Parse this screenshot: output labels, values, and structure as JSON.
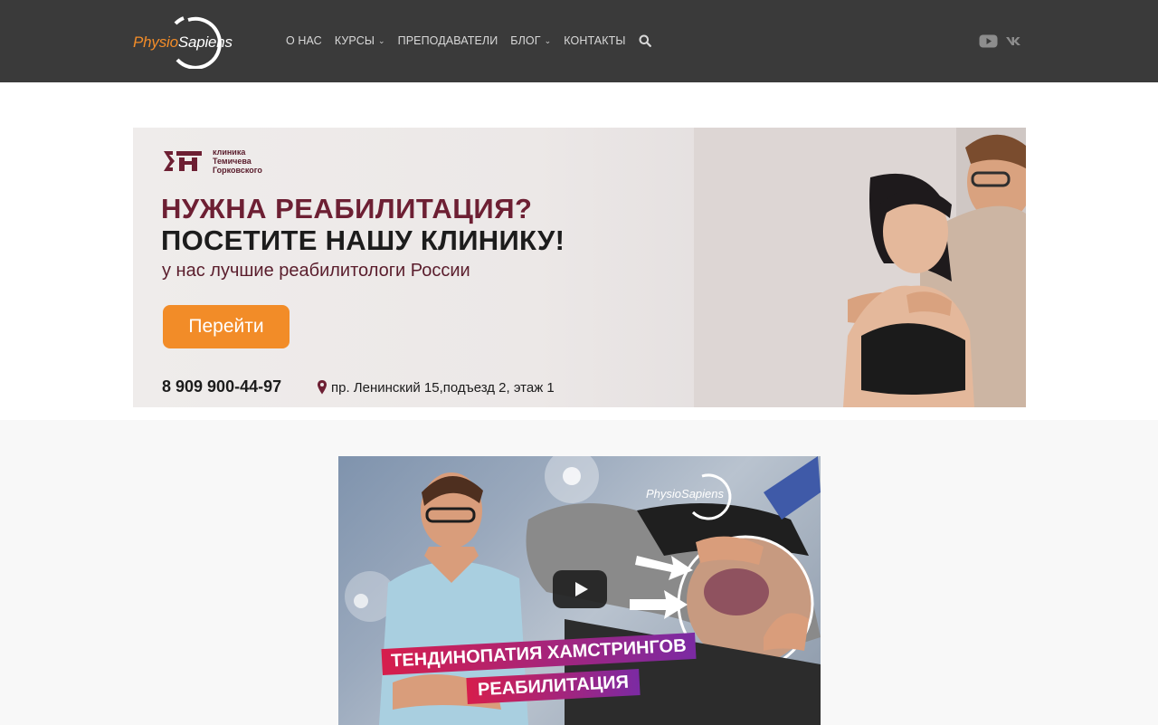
{
  "header": {
    "logo": {
      "part1": "Physio",
      "part2": "Sapiens"
    },
    "nav": [
      {
        "label": "О НАС",
        "has_dropdown": false
      },
      {
        "label": "КУРСЫ",
        "has_dropdown": true
      },
      {
        "label": "ПРЕПОДАВАТЕЛИ",
        "has_dropdown": false
      },
      {
        "label": "БЛОГ",
        "has_dropdown": true
      },
      {
        "label": "КОНТАКТЫ",
        "has_dropdown": false
      }
    ],
    "search_icon": "search-icon",
    "social": [
      "youtube-icon",
      "vk-icon"
    ],
    "colors": {
      "background": "#3a3a3a",
      "accent": "#f28c28"
    }
  },
  "banner": {
    "clinic_name": "клиника\nТемичева\nГорковского",
    "headline1": "НУЖНА РЕАБИЛИТАЦИЯ?",
    "headline2": "ПОСЕТИТЕ НАШУ КЛИНИКУ!",
    "subline": "у нас лучшие реабилитологи России",
    "button_label": "Перейти",
    "phone": "8 909 900-44-97",
    "address": "пр. Ленинский 15,подъезд 2, этаж 1",
    "colors": {
      "headline": "#6d1f33",
      "button": "#f28c28"
    }
  },
  "video": {
    "logo_text": "PhysioSapiens",
    "title_line1": "ТЕНДИНОПАТИЯ ХАМСТРИНГОВ",
    "title_line2": "РЕАБИЛИТАЦИЯ"
  }
}
